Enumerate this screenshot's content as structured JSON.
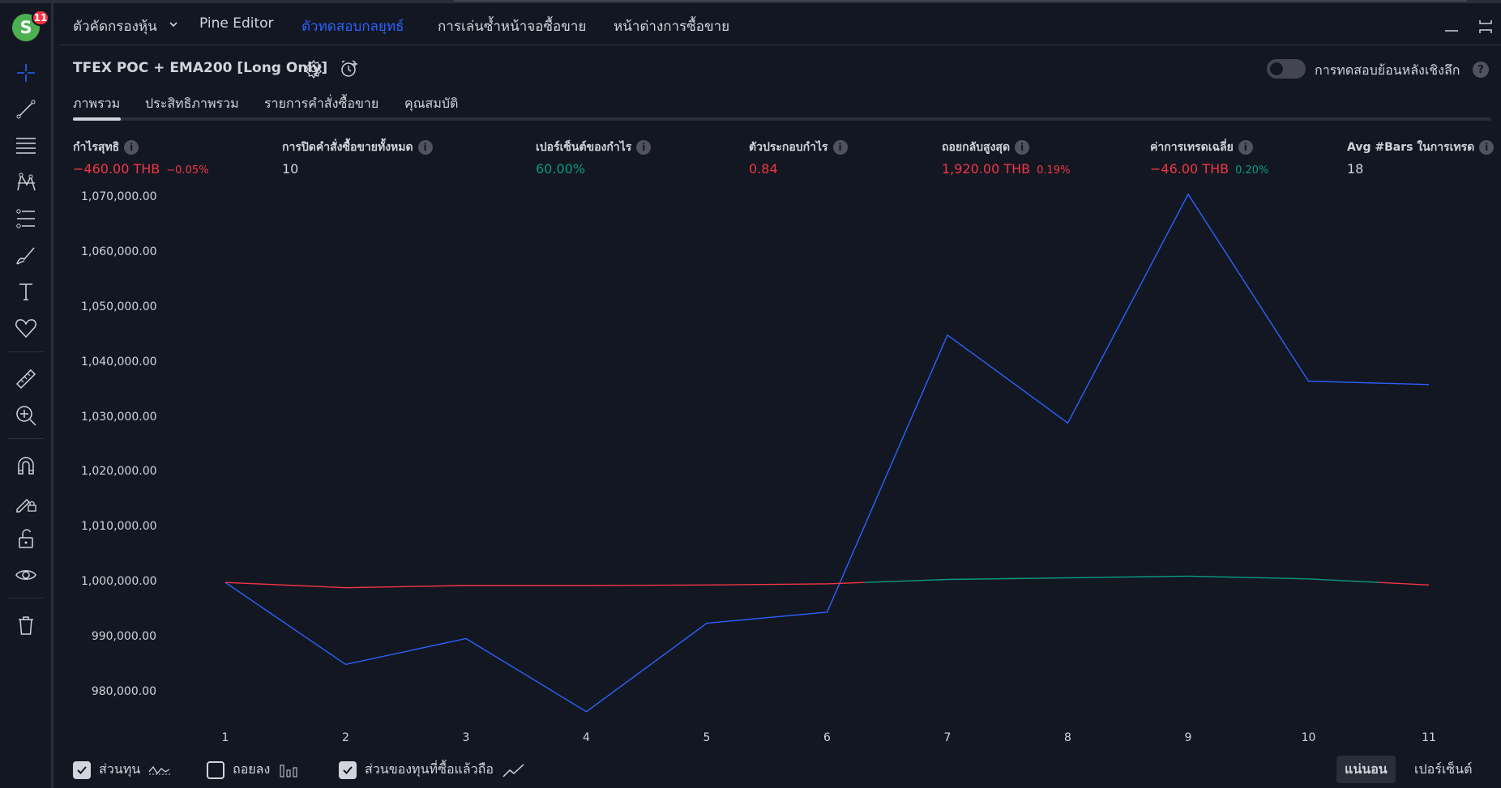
{
  "avatar": {
    "letter": "S",
    "badge": "11"
  },
  "nav": {
    "items": [
      "ตัวคัดกรองหุ้น",
      "Pine Editor",
      "ตัวทดสอบกลยุทธ์",
      "การเล่นซ้ำหน้าจอซื้อขาย",
      "หน้าต่างการซื้อขาย"
    ],
    "active_index": 2
  },
  "strategy": {
    "name": "TFEX POC + EMA200 [Long Only]",
    "deep_backtest_label": "การทดสอบย้อนหลังเชิงลึก",
    "help": "?"
  },
  "tabs": [
    "ภาพรวม",
    "ประสิทธิภาพรวม",
    "รายการคำสั่งซื้อขาย",
    "คุณสมบัติ"
  ],
  "info_icon": "i",
  "metrics": [
    {
      "label": "กำไรสุทธิ",
      "value": "−460.00 THB",
      "sub": "−0.05%",
      "value_color": "red",
      "sub_color": "red"
    },
    {
      "label": "การปิดคำสั่งซื้อขายทั้งหมด",
      "value": "10",
      "sub": "",
      "value_color": "white",
      "sub_color": "white"
    },
    {
      "label": "เปอร์เซ็นต์ของกำไร",
      "value": "60.00%",
      "sub": "",
      "value_color": "green",
      "sub_color": "green"
    },
    {
      "label": "ตัวประกอบกำไร",
      "value": "0.84",
      "sub": "",
      "value_color": "red",
      "sub_color": "red"
    },
    {
      "label": "ถอยกลับสูงสุด",
      "value": "1,920.00 THB",
      "sub": "0.19%",
      "value_color": "red",
      "sub_color": "red"
    },
    {
      "label": "ค่าการเทรดเฉลี่ย",
      "value": "−46.00 THB",
      "sub": "0.20%",
      "value_color": "red",
      "sub_color": "green"
    },
    {
      "label": "Avg #Bars ในการเทรด",
      "value": "18",
      "sub": "",
      "value_color": "white",
      "sub_color": "white"
    }
  ],
  "colors": {
    "background": "#131722",
    "accent": "#2962ff",
    "loss": "#f23645",
    "profit": "#089981",
    "text": "#d1d4dc"
  },
  "chart_data": {
    "type": "line",
    "x": [
      1,
      2,
      3,
      4,
      5,
      6,
      7,
      8,
      9,
      10,
      11
    ],
    "ylim": [
      975000,
      1072000
    ],
    "yticks": [
      980000,
      990000,
      1000000,
      1010000,
      1020000,
      1030000,
      1040000,
      1050000,
      1060000,
      1070000
    ],
    "ytick_labels": [
      "980,000.00",
      "990,000.00",
      "1,000,000.00",
      "1,010,000.00",
      "1,020,000.00",
      "1,030,000.00",
      "1,040,000.00",
      "1,050,000.00",
      "1,060,000.00",
      "1,070,000.00"
    ],
    "xtick_labels": [
      "1",
      "2",
      "3",
      "4",
      "5",
      "6",
      "7",
      "8",
      "9",
      "10",
      "11"
    ],
    "baseline": 1000000,
    "series": [
      {
        "name": "ส่วนทุน",
        "values": [
          1000000,
          999050,
          999450,
          999450,
          999550,
          999750,
          1000550,
          1000850,
          1001150,
          1000650,
          999540
        ]
      },
      {
        "name": "ส่วนของทุนที่ซื้อแล้วถือ",
        "color": "#2962ff",
        "values": [
          1000000,
          985100,
          989800,
          976500,
          992600,
          994600,
          1045000,
          1029000,
          1070600,
          1036600,
          1036000
        ]
      }
    ]
  },
  "legend": [
    {
      "label": "ส่วนทุน",
      "checked": true,
      "icon": "equity-wave-icon"
    },
    {
      "label": "ถอยลง",
      "checked": false,
      "icon": "drawdown-bars-icon"
    },
    {
      "label": "ส่วนของทุนที่ซื้อแล้วถือ",
      "checked": true,
      "icon": "buy-hold-line-icon"
    }
  ],
  "scale_mode": {
    "options": [
      "แน่นอน",
      "เปอร์เซ็นต์"
    ],
    "active_index": 0
  }
}
